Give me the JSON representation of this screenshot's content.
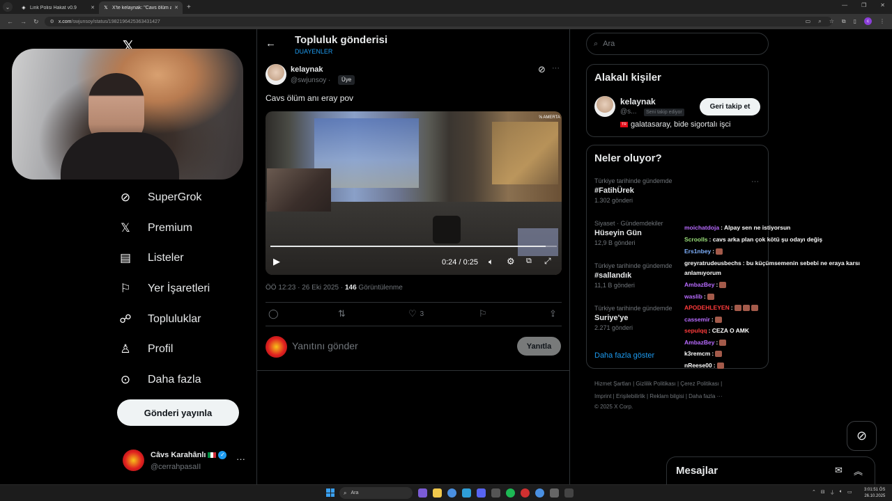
{
  "browser": {
    "tabs": [
      {
        "label": "Link Polisi Hakat v0.9",
        "active": false
      },
      {
        "label": "X'te kelaynak: \"Cavs ölüm anı e",
        "active": true
      }
    ],
    "url_host": "x.com",
    "url_path": "/swjunsoy/status/1982196425363431427"
  },
  "sidebar": {
    "items": [
      {
        "label": "SuperGrok",
        "icon": "grok-icon"
      },
      {
        "label": "Premium",
        "icon": "x-icon"
      },
      {
        "label": "Listeler",
        "icon": "list-icon"
      },
      {
        "label": "Yer İşaretleri",
        "icon": "bookmark-icon"
      },
      {
        "label": "Topluluklar",
        "icon": "communities-icon"
      },
      {
        "label": "Profil",
        "icon": "profile-icon"
      },
      {
        "label": "Daha fazla",
        "icon": "more-circle-icon"
      }
    ],
    "post_button": "Gönderi yayınla",
    "account": {
      "name": "Câvs Karahânlı",
      "handle": "@cerrahpasaII"
    }
  },
  "main": {
    "title": "Topluluk gönderisi",
    "subtitle": "DUAYENLER",
    "post": {
      "author": "kelaynak",
      "handle": "@swjunsoy ·",
      "badge": "Üye",
      "text": "Cavs ölüm anı eray pov",
      "video": {
        "time": "0:24 / 0:25",
        "progress": 0.96,
        "overlay_text": "⅝ AMERTA"
      },
      "timestamp": "ÖÖ 12:23 · 26 Eki 2025 ·",
      "views": "146",
      "views_label": "Görüntülenme",
      "likes": "3"
    },
    "reply": {
      "placeholder": "Yanıtını gönder",
      "button": "Yanıtla"
    }
  },
  "right": {
    "search_placeholder": "Ara",
    "related": {
      "title": "Alakalı kişiler",
      "name": "kelaynak",
      "handle": "@s...",
      "badge": "Seni takip ediyor",
      "follow_button": "Geri takip et",
      "bio": "galatasaray, bide sigortalı işci",
      "bio_flag": "TR"
    },
    "trends": {
      "title": "Neler oluyor?",
      "items": [
        {
          "context": "Türkiye tarihinde gündemde",
          "name": "#FatihÜrek",
          "count": "1.302 gönderi"
        },
        {
          "context": "Siyaset · Gündemdekiler",
          "name": "Hüseyin Gün",
          "count": "12,9 B gönderi"
        },
        {
          "context": "Türkiye tarihinde gündemde",
          "name": "#sallandık",
          "count": "11,1 B gönderi"
        },
        {
          "context": "Türkiye tarihinde gündemde",
          "name": "Suriye'ye",
          "count": "2.271 gönderi"
        }
      ],
      "show_more": "Daha fazla göster"
    },
    "footer": {
      "line1": "Hizmet Şartları  |   Gizlilik Politikası  |   Çerez Politikası  |",
      "line2": "Imprint  |   Erişilebilirlik  |   Reklam bilgisi  |   Daha fazla ···",
      "line3": "© 2025 X Corp."
    }
  },
  "chat": [
    {
      "user": "moichatdoja",
      "color": "#b86bff",
      "text": ": Alpay sen ne istiyorsun",
      "emotes": 0
    },
    {
      "user": "Scroolls",
      "color": "#9be07a",
      "text": ": cavs arka plan çok kötü şu odayı değiş",
      "emotes": 0
    },
    {
      "user": "Ers1nbey",
      "color": "#7fb2ff",
      "text": ":",
      "emotes": 1
    },
    {
      "user": "greyratrudeusbechs",
      "color": "#ffffff",
      "text": ": bu küçümsemenin sebebi ne eraya karsı",
      "emotes": 0
    },
    {
      "user": "",
      "color": "#ffffff",
      "text": "anlamıyorum",
      "emotes": 0
    },
    {
      "user": "AmbazBey",
      "color": "#b86bff",
      "text": ":",
      "emotes": 1
    },
    {
      "user": "waslib",
      "color": "#b86bff",
      "text": ":",
      "emotes": 1
    },
    {
      "user": "APODEHLEYEN",
      "color": "#ff3b3b",
      "text": ":",
      "emotes": 3
    },
    {
      "user": "cassemir",
      "color": "#b86bff",
      "text": ":",
      "emotes": 1
    },
    {
      "user": "sepulqq",
      "color": "#ff3b3b",
      "text": ": CEZA O AMK",
      "emotes": 0
    },
    {
      "user": "AmbazBey",
      "color": "#b86bff",
      "text": ":",
      "emotes": 1
    },
    {
      "user": "k3remcm",
      "color": "#ffffff",
      "text": ":",
      "emotes": 1
    },
    {
      "user": "nReese00",
      "color": "#ffffff",
      "text": ":",
      "emotes": 1
    }
  ],
  "messages": {
    "title": "Mesajlar"
  },
  "taskbar": {
    "search": "Ara",
    "time": "3:01:51 ÖS",
    "date": "26.10.2025"
  }
}
